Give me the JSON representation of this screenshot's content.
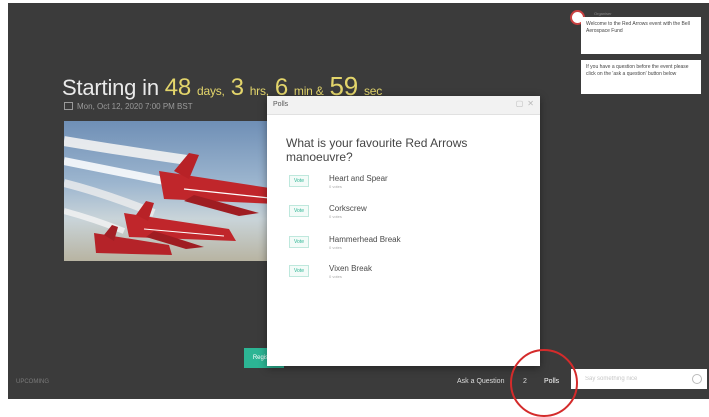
{
  "countdown": {
    "prefix": "Starting in",
    "days": "48",
    "days_unit": "days,",
    "hours": "3",
    "hours_unit": "hrs,",
    "minutes": "6",
    "minutes_unit": "min &",
    "seconds": "59",
    "seconds_unit": "sec"
  },
  "event_date": "Mon, Oct 12, 2020 7:00 PM BST",
  "register_label": "Register",
  "footer_left": "UPCOMING",
  "polls": {
    "title": "Polls",
    "question": "What is your favourite Red Arrows manoeuvre?",
    "vote_label": "Vote",
    "options": [
      {
        "label": "Heart and Spear",
        "sub": "0 votes"
      },
      {
        "label": "Corkscrew",
        "sub": "0 votes"
      },
      {
        "label": "Hammerhead Break",
        "sub": "0 votes"
      },
      {
        "label": "Vixen Break",
        "sub": "0 votes"
      }
    ]
  },
  "bottom_bar": {
    "ask_question": "Ask a Question",
    "ask_count": "2",
    "polls_tab": "Polls",
    "chat_placeholder": "Say something nice"
  },
  "chat": {
    "author": "Organiser",
    "messages": [
      "Welcome to the Red Arrows event with the Bell Aerospace Fund",
      "If you have a question before the event please click on the 'ask a question' button below"
    ]
  },
  "colors": {
    "accent": "#2cb594",
    "countdown_highlight": "#e3d56b",
    "annotation_ring": "#d42b2b"
  }
}
